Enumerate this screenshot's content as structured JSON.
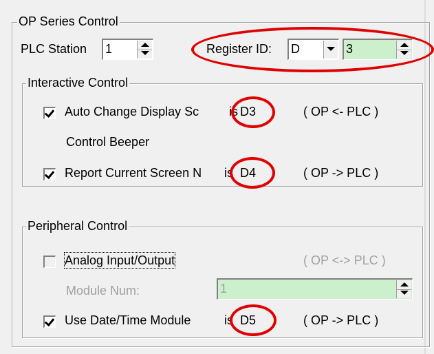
{
  "op_series": {
    "legend": "OP Series Control",
    "plc_station_label": "PLC Station",
    "plc_station_value": "1",
    "register_id_label": "Register ID:",
    "register_type": "D",
    "register_number": "3"
  },
  "interactive": {
    "legend": "Interactive Control",
    "auto_change_label": "Auto Change Display Sc",
    "auto_change_is": "is",
    "auto_change_reg": "D3",
    "auto_change_dir": "( OP <- PLC )",
    "control_beeper_label": "Control Beeper",
    "report_screen_label": "Report Current Screen N",
    "report_screen_is": "is",
    "report_screen_reg": "D4",
    "report_screen_dir": "( OP -> PLC )"
  },
  "peripheral": {
    "legend": "Peripheral Control",
    "analog_label": "Analog Input/Output",
    "analog_dir": "( OP <-> PLC )",
    "module_num_label": "Module Num:",
    "module_num_value": "1",
    "date_time_label": "Use Date/Time Module",
    "date_time_is": "is",
    "date_time_reg": "D5",
    "date_time_dir": "( OP -> PLC )"
  },
  "colors": {
    "field_green": "#ccf0cc",
    "annotation_red": "#e00000",
    "background": "#f0f0f0"
  }
}
